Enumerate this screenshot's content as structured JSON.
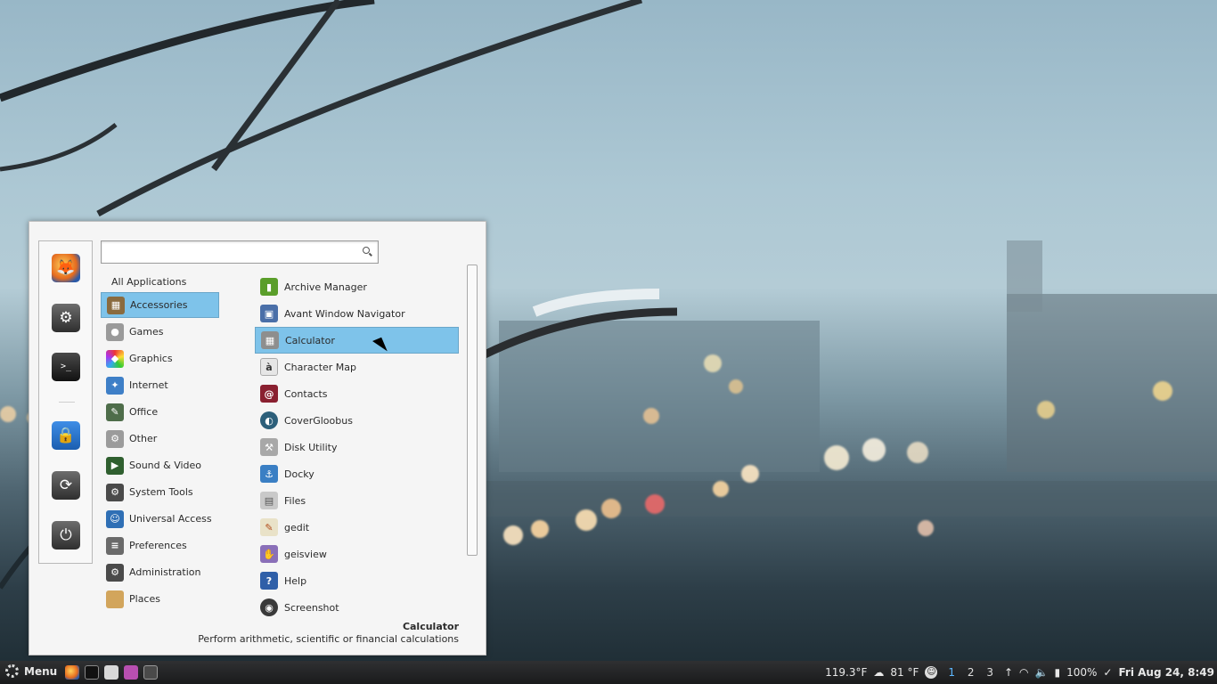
{
  "search": {
    "value": "",
    "placeholder": ""
  },
  "categories_header": "All Applications",
  "categories": [
    {
      "label": "Accessories",
      "icon": "accessories-icon",
      "color": "#8a6b3f",
      "glyph": "▦",
      "selected": true
    },
    {
      "label": "Games",
      "icon": "games-icon",
      "color": "#9a9a9a",
      "glyph": "●"
    },
    {
      "label": "Graphics",
      "icon": "graphics-icon",
      "color": "#d63d7a",
      "glyph": "◆"
    },
    {
      "label": "Internet",
      "icon": "internet-icon",
      "color": "#3e7fc7",
      "glyph": "✦"
    },
    {
      "label": "Office",
      "icon": "office-icon",
      "color": "#4e6d4a",
      "glyph": "✎"
    },
    {
      "label": "Other",
      "icon": "other-icon",
      "color": "#9b9b9b",
      "glyph": "⚙"
    },
    {
      "label": "Sound & Video",
      "icon": "sound-video-icon",
      "color": "#2f5f2f",
      "glyph": "▶"
    },
    {
      "label": "System Tools",
      "icon": "system-tools-icon",
      "color": "#4a4a4a",
      "glyph": "⚙"
    },
    {
      "label": "Universal Access",
      "icon": "universal-access-icon",
      "color": "#2f6fb5",
      "glyph": "☺"
    },
    {
      "label": "Preferences",
      "icon": "preferences-icon",
      "color": "#6a6a6a",
      "glyph": "≡"
    },
    {
      "label": "Administration",
      "icon": "administration-icon",
      "color": "#4a4a4a",
      "glyph": "⚙"
    },
    {
      "label": "Places",
      "icon": "folder-icon",
      "color": "#d2a55c",
      "glyph": ""
    }
  ],
  "apps": [
    {
      "label": "Archive Manager",
      "icon": "archive-manager-icon",
      "color": "#5a9e2a",
      "glyph": "▮"
    },
    {
      "label": "Avant Window Navigator",
      "icon": "avant-window-navigator-icon",
      "color": "#4a6fa8",
      "glyph": "▣"
    },
    {
      "label": "Calculator",
      "icon": "calculator-icon",
      "color": "#8e8e8e",
      "glyph": "▦",
      "selected": true
    },
    {
      "label": "Character Map",
      "icon": "character-map-icon",
      "color": "#e6e6e6",
      "glyph": "à",
      "dark": true
    },
    {
      "label": "Contacts",
      "icon": "contacts-icon",
      "color": "#8a2030",
      "glyph": "@"
    },
    {
      "label": "CoverGloobus",
      "icon": "covergloobus-icon",
      "color": "#2c5f7a",
      "glyph": "◐"
    },
    {
      "label": "Disk Utility",
      "icon": "disk-utility-icon",
      "color": "#a8a8a8",
      "glyph": "⚒"
    },
    {
      "label": "Docky",
      "icon": "docky-icon",
      "color": "#3a7fc4",
      "glyph": "⚓"
    },
    {
      "label": "Files",
      "icon": "files-icon",
      "color": "#c9c9c9",
      "glyph": "▤"
    },
    {
      "label": "gedit",
      "icon": "gedit-icon",
      "color": "#e9e2c8",
      "glyph": "✎",
      "dark": true
    },
    {
      "label": "geisview",
      "icon": "geisview-icon",
      "color": "#8a6fb8",
      "glyph": "✋"
    },
    {
      "label": "Help",
      "icon": "help-icon",
      "color": "#2f5fa8",
      "glyph": "?"
    },
    {
      "label": "Screenshot",
      "icon": "screenshot-icon",
      "color": "#3a3a3a",
      "glyph": "◉"
    }
  ],
  "description": {
    "title": "Calculator",
    "text": "Perform arithmetic, scientific or financial calculations"
  },
  "favorites": [
    {
      "icon": "firefox-icon",
      "glyph": "🦊",
      "color": "#e56b1f"
    },
    {
      "icon": "system-settings-icon",
      "glyph": "⚙"
    },
    {
      "icon": "terminal-icon",
      "glyph": ">_"
    },
    {
      "icon": "lock-screen-icon",
      "glyph": "🔒",
      "color": "#2e7bd6"
    },
    {
      "icon": "logout-icon",
      "glyph": "⟳"
    },
    {
      "icon": "shutdown-icon",
      "glyph": "⏻"
    }
  ],
  "taskbar": {
    "menu_label": "Menu",
    "temp1": "119.3°F",
    "temp2": "81 °F",
    "workspaces": [
      "1",
      "2",
      "3"
    ],
    "active_workspace": "1",
    "battery": "100%",
    "clock": "Fri Aug 24,  8:49"
  }
}
